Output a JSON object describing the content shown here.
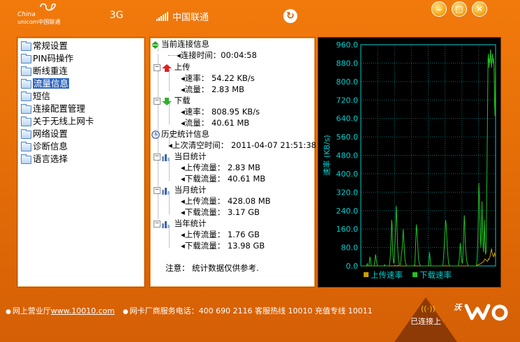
{
  "titlebar": {
    "logo_line1": "China",
    "logo_line2": "unicom中国联通",
    "network_type": "3G",
    "operator": "中国联通",
    "refresh_icon": "refresh-icon",
    "min_icon": "minimize-icon",
    "max_icon": "maximize-icon",
    "close_icon": "close-icon"
  },
  "nav": {
    "items": [
      {
        "label": "常规设置"
      },
      {
        "label": "PIN码操作"
      },
      {
        "label": "断线重连"
      },
      {
        "label": "流量信息",
        "selected": true
      },
      {
        "label": "短信"
      },
      {
        "label": "连接配置管理"
      },
      {
        "label": "关于无线上网卡"
      },
      {
        "label": "网络设置"
      },
      {
        "label": "诊断信息"
      },
      {
        "label": "语言选择"
      }
    ]
  },
  "info": {
    "current": {
      "title": "当前连接信息",
      "connect_time_label": "连接时间：",
      "connect_time": "00:04:58",
      "upload_title": "上传",
      "upload_rate_label": "速率：",
      "upload_rate": "54.22 KB/s",
      "upload_flow_label": "流量：",
      "upload_flow": "2.83 MB",
      "download_title": "下载",
      "download_rate_label": "速率：",
      "download_rate": "808.95 KB/s",
      "download_flow_label": "流量：",
      "download_flow": "40.61 MB"
    },
    "history": {
      "title": "历史统计信息",
      "last_clear_label": "上次清空时间：",
      "last_clear": "2011-04-07 21:51:38",
      "day_title": "当日统计",
      "day_up_label": "上传流量：",
      "day_up": "2.83 MB",
      "day_down_label": "下载流量：",
      "day_down": "40.61 MB",
      "month_title": "当月统计",
      "month_up_label": "上传流量：",
      "month_up": "428.08 MB",
      "month_down_label": "下载流量：",
      "month_down": "3.17 GB",
      "year_title": "当年统计",
      "year_up_label": "上传流量：",
      "year_up": "1.76 GB",
      "year_down_label": "下载流量：",
      "year_down": "13.98 GB"
    },
    "note": "注意：  统计数据仅供参考."
  },
  "chart_data": {
    "type": "line",
    "ylabel": "速率 (KB/s)",
    "ylim": [
      0,
      960
    ],
    "yticks": [
      "960.0",
      "880.0",
      "800.0",
      "720.0",
      "640.0",
      "560.0",
      "480.0",
      "400.0",
      "320.0",
      "240.0",
      "160.0",
      "80.0",
      "0.0"
    ],
    "grid": true,
    "legend_position": "bottom",
    "colors": {
      "upload": "#c8a000",
      "download": "#22c422",
      "axis": "#00d0d0",
      "grid": "#007070"
    },
    "series": [
      {
        "name": "上传速率",
        "values": [
          0,
          0,
          0,
          0,
          0,
          0,
          0,
          0,
          0,
          0,
          0,
          0,
          0,
          0,
          0,
          0,
          0,
          0,
          0,
          0,
          0,
          0,
          0,
          0,
          0,
          0,
          0,
          0,
          0,
          0,
          0,
          0,
          0,
          0,
          0,
          0,
          0,
          0,
          0,
          0,
          0,
          0,
          0,
          0,
          0,
          0,
          0,
          2,
          0,
          0,
          0,
          0,
          0,
          0,
          0,
          0,
          0,
          0,
          0,
          0,
          0,
          0,
          0,
          0,
          0,
          0,
          0,
          3,
          0,
          0,
          0,
          0,
          0,
          4,
          0,
          0,
          0,
          0,
          0,
          0,
          0,
          0,
          0,
          0,
          0,
          0,
          0,
          0,
          0,
          0,
          0,
          0,
          0,
          0,
          0,
          0,
          0,
          0,
          0,
          0,
          0,
          0,
          0,
          0,
          0,
          5,
          0,
          0,
          0,
          0,
          0,
          0,
          0,
          0,
          0,
          0,
          0,
          0,
          0,
          0,
          0,
          0,
          0,
          0,
          0,
          0,
          0,
          0,
          0,
          0,
          0,
          0,
          0,
          0,
          0,
          0,
          0,
          0,
          0,
          0,
          0,
          0,
          0,
          0,
          0,
          0,
          0,
          0,
          0,
          0,
          0,
          0,
          0,
          0,
          0,
          0,
          0,
          0,
          0,
          0,
          0,
          0,
          0,
          0,
          0,
          0,
          0,
          0,
          0,
          0,
          0,
          0,
          0,
          0,
          0,
          0,
          0,
          0,
          0,
          0,
          0,
          0,
          0,
          0,
          0,
          0,
          0,
          0,
          0,
          0,
          0,
          0,
          0,
          0,
          0,
          0,
          0,
          0,
          0,
          0,
          0,
          0,
          0,
          0,
          0,
          0,
          0,
          0,
          0,
          0,
          0,
          0,
          0,
          0,
          0,
          0,
          0,
          0,
          0,
          0,
          0,
          0,
          0,
          0,
          0,
          0,
          0,
          2,
          3,
          4,
          5,
          6,
          7,
          8,
          9,
          10,
          12,
          14,
          15,
          16,
          18,
          20,
          25,
          30,
          28,
          26,
          24,
          22,
          20,
          25,
          30,
          28,
          35,
          40,
          50,
          60,
          75,
          60,
          50,
          45,
          40,
          50,
          55,
          45,
          40
        ]
      },
      {
        "name": "下载速率",
        "values": [
          0,
          0,
          0,
          0,
          0,
          0,
          0,
          0,
          0,
          0,
          0,
          0,
          5,
          10,
          0,
          0,
          0,
          20,
          40,
          30,
          10,
          0,
          0,
          0,
          0,
          0,
          0,
          10,
          25,
          50,
          40,
          20,
          10,
          0,
          0,
          0,
          0,
          0,
          0,
          0,
          0,
          0,
          0,
          0,
          0,
          0,
          0,
          5,
          0,
          0,
          0,
          0,
          0,
          0,
          0,
          0,
          0,
          10,
          30,
          60,
          120,
          200,
          180,
          80,
          30,
          10,
          20,
          60,
          120,
          180,
          260,
          220,
          150,
          80,
          40,
          20,
          10,
          5,
          5,
          10,
          40,
          60,
          80,
          120,
          160,
          120,
          80,
          40,
          20,
          10,
          5,
          0,
          0,
          0,
          0,
          0,
          0,
          0,
          0,
          0,
          0,
          0,
          0,
          0,
          0,
          0,
          0,
          10,
          60,
          120,
          180,
          160,
          120,
          80,
          40,
          20,
          10,
          5,
          0,
          0,
          0,
          0,
          0,
          0,
          0,
          0,
          0,
          0,
          0,
          0,
          0,
          0,
          0,
          0,
          0,
          20,
          60,
          40,
          20,
          0,
          0,
          0,
          0,
          0,
          0,
          0,
          0,
          0,
          0,
          0,
          0,
          0,
          0,
          0,
          0,
          0,
          0,
          0,
          0,
          0,
          0,
          0,
          0,
          10,
          40,
          80,
          120,
          160,
          200,
          180,
          140,
          100,
          60,
          30,
          10,
          5,
          0,
          0,
          0,
          0,
          0,
          0,
          0,
          0,
          0,
          0,
          0,
          0,
          0,
          0,
          0,
          0,
          0,
          0,
          10,
          30,
          60,
          100,
          80,
          40,
          20,
          10,
          30,
          80,
          160,
          220,
          180,
          100,
          60,
          40,
          20,
          10,
          5,
          0,
          0,
          0,
          0,
          0,
          0,
          0,
          0,
          0,
          0,
          0,
          0,
          0,
          0,
          0,
          0,
          0,
          20,
          60,
          120,
          240,
          360,
          300,
          200,
          120,
          80,
          160,
          280,
          180,
          100,
          60,
          120,
          200,
          100,
          50,
          60,
          200,
          400,
          640,
          900,
          920,
          860,
          900,
          880,
          940,
          900,
          860,
          900,
          920,
          880,
          900,
          860,
          700,
          650,
          900
        ]
      }
    ],
    "legend": [
      "上传速率",
      "下载速率"
    ]
  },
  "footer": {
    "item1_label": "网上营业厅",
    "item1_link": "www.10010.com",
    "item2": "网卡厂商服务电话：400 690 2116  客服热线 10010  充值专线 10011",
    "status": "已连接上",
    "brand": "沃"
  }
}
